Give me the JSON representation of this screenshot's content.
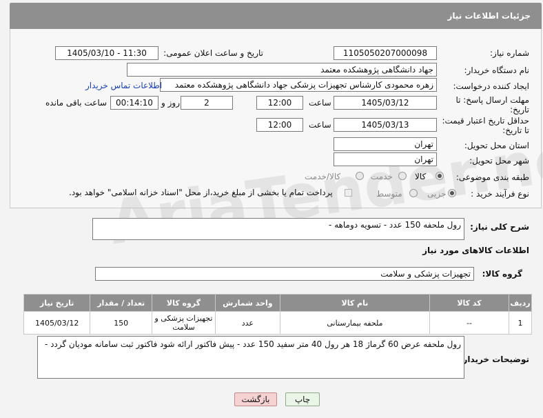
{
  "header": {
    "title": "جزئیات اطلاعات نیاز"
  },
  "form": {
    "need_number_label": "شماره نیاز:",
    "need_number": "1105050207000098",
    "announce_label": "تاریخ و ساعت اعلان عمومی:",
    "announce_value": "1405/03/10 - 11:30",
    "buyer_org_label": "نام دستگاه خریدار:",
    "buyer_org": "جهاد دانشگاهی پژوهشکده معتمد",
    "requester_label": "ایجاد کننده درخواست:",
    "requester": "زهره محمودی کارشناس تجهیزات پزشکی جهاد دانشگاهی پژوهشکده معتمد",
    "contact_link": "اطلاعات تماس خریدار",
    "deadline_label_1": "مهلت ارسال پاسخ: تا",
    "deadline_label_2": "تاریخ:",
    "deadline_date": "1405/03/12",
    "time_label": "ساعت",
    "deadline_time": "12:00",
    "days_value": "2",
    "days_label": "روز و",
    "remaining_time": "00:14:10",
    "remaining_label": "ساعت باقی مانده",
    "validity_label_1": "حداقل تاریخ اعتبار قیمت:",
    "validity_label_2": "تا تاریخ:",
    "validity_date": "1405/03/13",
    "validity_time": "12:00",
    "province_label": "استان محل تحویل:",
    "province": "تهران",
    "city_label": "شهر محل تحویل:",
    "city": "تهران",
    "category_label": "طبقه بندی موضوعی:",
    "category_options": [
      "کالا",
      "خدمت",
      "کالا/خدمت"
    ],
    "category_selected": "کالا",
    "process_label": "نوع فرآیند خرید :",
    "process_options": [
      "جزیی",
      "متوسط"
    ],
    "process_selected": "جزیی",
    "payment_note": "پرداخت تمام یا بخشی از مبلغ خرید،از محل \"اسناد خزانه اسلامی\" خواهد بود."
  },
  "summary": {
    "label": "شرح کلی نیاز:",
    "value": "رول ملحفه 150 عدد - تسویه دوماهه -"
  },
  "goods": {
    "section_title": "اطلاعات کالاهای مورد نیاز",
    "group_label": "گروه کالا:",
    "group_value": "تجهیزات پزشکی و سلامت",
    "columns": [
      "ردیف",
      "کد کالا",
      "نام کالا",
      "واحد شمارش",
      "گروه کالا",
      "تعداد / مقدار",
      "تاریخ نیاز"
    ],
    "rows": [
      {
        "row": "1",
        "code": "--",
        "name": "ملحفه بیمارستانی",
        "unit": "عدد",
        "group": "تجهیزات پزشکی و سلامت",
        "qty": "150",
        "date": "1405/03/12"
      }
    ]
  },
  "buyer_notes": {
    "label": "توضیحات خریدار:",
    "value": "رول ملحفه عرض 60 گرماژ 18  هر رول 40 متر سفید  150 عدد - پیش فاکتور ارائه شود فاکتور ثبت سامانه مودیان گردد -"
  },
  "buttons": {
    "print": "چاپ",
    "back": "بازگشت"
  },
  "watermark": "AriaTender.neT",
  "colors": {
    "header_bg": "#8f8f8f",
    "link": "#1a3fb0",
    "back_button_bg": "#f6d2d2"
  }
}
